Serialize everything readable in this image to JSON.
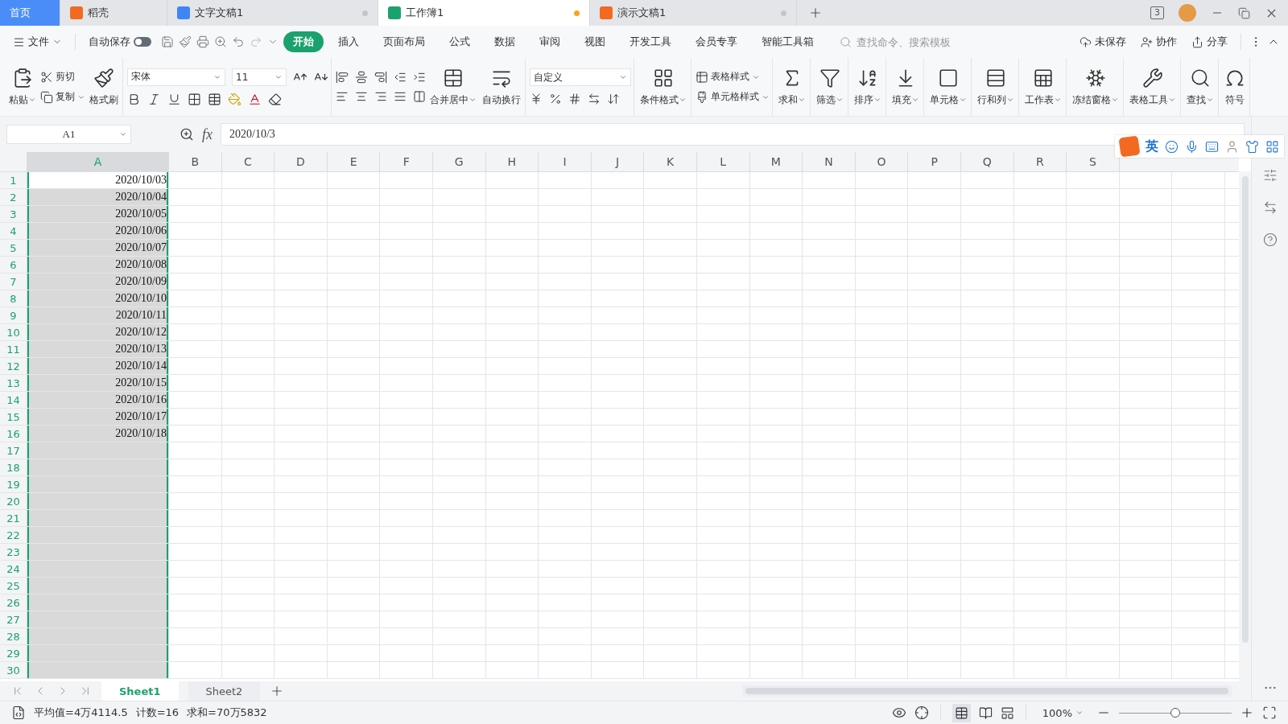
{
  "tabs": [
    {
      "kind": "home",
      "label": "首页",
      "selected": false
    },
    {
      "kind": "docer",
      "label": "稻壳",
      "selected": false
    },
    {
      "kind": "writer",
      "label": "文字文稿1",
      "selected": false,
      "unsaved": false
    },
    {
      "kind": "sheet",
      "label": "工作簿1",
      "selected": true,
      "unsaved": true
    },
    {
      "kind": "slides",
      "label": "演示文稿1",
      "selected": false,
      "unsaved": false
    }
  ],
  "title_bar": {
    "window_count": "3"
  },
  "menu": {
    "file": "文件",
    "autosave": {
      "label": "自动保存",
      "on": false
    },
    "tabs": [
      {
        "label": "开始",
        "selected": true
      },
      {
        "label": "插入",
        "selected": false
      },
      {
        "label": "页面布局",
        "selected": false
      },
      {
        "label": "公式",
        "selected": false
      },
      {
        "label": "数据",
        "selected": false
      },
      {
        "label": "审阅",
        "selected": false
      },
      {
        "label": "视图",
        "selected": false
      },
      {
        "label": "开发工具",
        "selected": false
      },
      {
        "label": "会员专享",
        "selected": false
      },
      {
        "label": "智能工具箱",
        "selected": false
      }
    ],
    "search": {
      "placeholder": "查找命令、搜索模板"
    },
    "actions": [
      "未保存",
      "协作",
      "分享"
    ]
  },
  "ribbon": {
    "paste": "粘贴",
    "cut": "剪切",
    "copy": "复制",
    "format_painter": "格式刷",
    "font_name": "宋体",
    "font_size": "11",
    "merge": "合并居中",
    "wrap": "自动换行",
    "number_format": "自定义",
    "commands": [
      {
        "kind": "large",
        "label": "条件格式",
        "dropdown": true
      },
      {
        "kind": "stack",
        "items": [
          {
            "label": "表格样式",
            "dropdown": true
          },
          {
            "label": "单元格样式",
            "dropdown": true
          }
        ]
      },
      {
        "kind": "large",
        "label": "求和",
        "dropdown": true
      },
      {
        "kind": "large",
        "label": "筛选",
        "dropdown": true
      },
      {
        "kind": "large",
        "label": "排序",
        "dropdown": true
      },
      {
        "kind": "large",
        "label": "填充",
        "dropdown": true
      },
      {
        "kind": "large",
        "label": "单元格",
        "dropdown": true
      },
      {
        "kind": "large",
        "label": "行和列",
        "dropdown": true
      },
      {
        "kind": "large",
        "label": "工作表",
        "dropdown": true
      },
      {
        "kind": "large",
        "label": "冻结窗格",
        "dropdown": true
      },
      {
        "kind": "large",
        "label": "表格工具",
        "dropdown": true
      },
      {
        "kind": "large",
        "label": "查找",
        "dropdown": true
      },
      {
        "kind": "large",
        "label": "符号",
        "dropdown": false
      }
    ]
  },
  "formula_bar": {
    "cell": "A1",
    "fx_label": "fx",
    "formula": "2020/10/3"
  },
  "ime_toolbar": {
    "mode": "英"
  },
  "sheet": {
    "columns": [
      {
        "label": "A",
        "selected": true
      },
      {
        "label": "B",
        "selected": false
      },
      {
        "label": "C",
        "selected": false
      },
      {
        "label": "D",
        "selected": false
      },
      {
        "label": "E",
        "selected": false
      },
      {
        "label": "F",
        "selected": false
      },
      {
        "label": "G",
        "selected": false
      },
      {
        "label": "H",
        "selected": false
      },
      {
        "label": "I",
        "selected": false
      },
      {
        "label": "J",
        "selected": false
      },
      {
        "label": "K",
        "selected": false
      },
      {
        "label": "L",
        "selected": false
      },
      {
        "label": "M",
        "selected": false
      },
      {
        "label": "N",
        "selected": false
      },
      {
        "label": "O",
        "selected": false
      },
      {
        "label": "P",
        "selected": false
      },
      {
        "label": "Q",
        "selected": false
      },
      {
        "label": "R",
        "selected": false
      },
      {
        "label": "S",
        "selected": false
      }
    ],
    "rows": [
      {
        "number": "1",
        "cells": [
          "2020/10/03"
        ]
      },
      {
        "number": "2",
        "cells": [
          "2020/10/04"
        ]
      },
      {
        "number": "3",
        "cells": [
          "2020/10/05"
        ]
      },
      {
        "number": "4",
        "cells": [
          "2020/10/06"
        ]
      },
      {
        "number": "5",
        "cells": [
          "2020/10/07"
        ]
      },
      {
        "number": "6",
        "cells": [
          "2020/10/08"
        ]
      },
      {
        "number": "7",
        "cells": [
          "2020/10/09"
        ]
      },
      {
        "number": "8",
        "cells": [
          "2020/10/10"
        ]
      },
      {
        "number": "9",
        "cells": [
          "2020/10/11"
        ]
      },
      {
        "number": "10",
        "cells": [
          "2020/10/12"
        ]
      },
      {
        "number": "11",
        "cells": [
          "2020/10/13"
        ]
      },
      {
        "number": "12",
        "cells": [
          "2020/10/14"
        ]
      },
      {
        "number": "13",
        "cells": [
          "2020/10/15"
        ]
      },
      {
        "number": "14",
        "cells": [
          "2020/10/16"
        ]
      },
      {
        "number": "15",
        "cells": [
          "2020/10/17"
        ]
      },
      {
        "number": "16",
        "cells": [
          "2020/10/18"
        ]
      },
      {
        "number": "17"
      },
      {
        "number": "18"
      },
      {
        "number": "19"
      },
      {
        "number": "20"
      },
      {
        "number": "21"
      },
      {
        "number": "22"
      },
      {
        "number": "23"
      },
      {
        "number": "24"
      },
      {
        "number": "25"
      },
      {
        "number": "26"
      },
      {
        "number": "27"
      },
      {
        "number": "28"
      },
      {
        "number": "29"
      },
      {
        "number": "30"
      }
    ]
  },
  "sheet_tabs": [
    {
      "label": "Sheet1",
      "selected": true
    },
    {
      "label": "Sheet2",
      "selected": false
    }
  ],
  "status_bar": {
    "stats": [
      "平均值=4万4114.5",
      "计数=16",
      "求和=70万5832"
    ],
    "zoom": "100%",
    "zoom_slider": {
      "level": 0.5
    }
  }
}
